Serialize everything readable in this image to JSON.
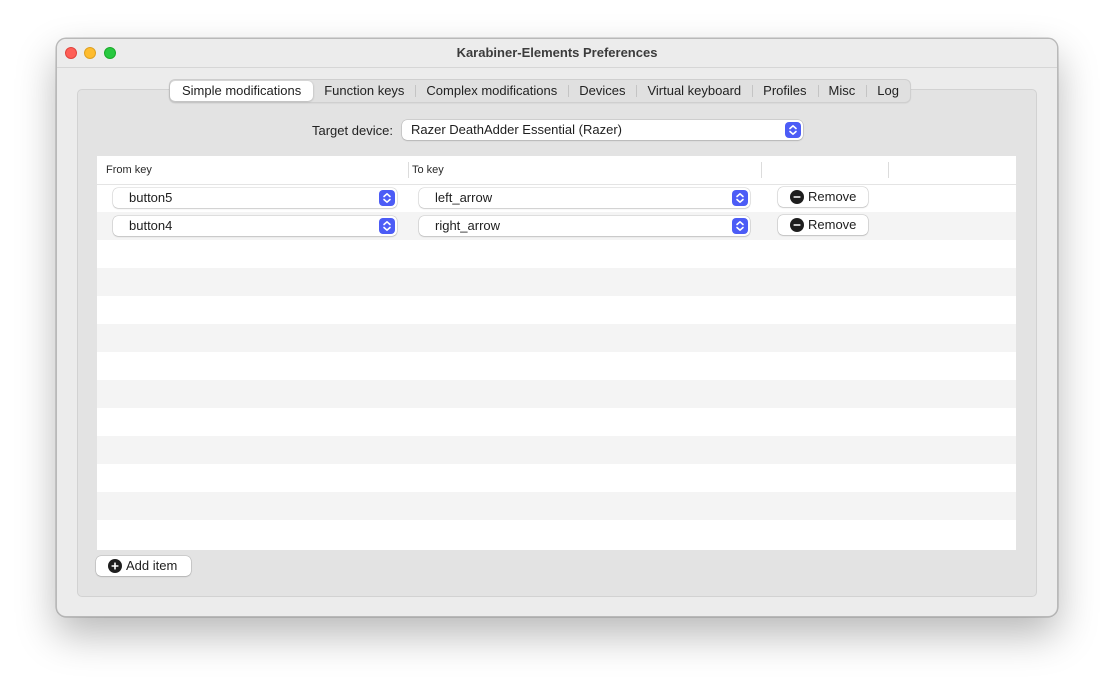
{
  "window": {
    "title": "Karabiner-Elements Preferences"
  },
  "tabs": [
    {
      "label": "Simple modifications",
      "active": true
    },
    {
      "label": "Function keys",
      "active": false
    },
    {
      "label": "Complex modifications",
      "active": false
    },
    {
      "label": "Devices",
      "active": false
    },
    {
      "label": "Virtual keyboard",
      "active": false
    },
    {
      "label": "Profiles",
      "active": false
    },
    {
      "label": "Misc",
      "active": false
    },
    {
      "label": "Log",
      "active": false
    }
  ],
  "target_device": {
    "label": "Target device:",
    "value": "Razer DeathAdder Essential (Razer)"
  },
  "table": {
    "columns": [
      "From key",
      "To key"
    ],
    "rows": [
      {
        "from": "button5",
        "to": "left_arrow",
        "remove_label": "Remove"
      },
      {
        "from": "button4",
        "to": "right_arrow",
        "remove_label": "Remove"
      }
    ]
  },
  "add_item": {
    "label": "Add item"
  },
  "colors": {
    "accent": "#4c5cf6",
    "close": "#ff5f57",
    "minimize": "#febc2e",
    "maximize": "#28c840"
  }
}
